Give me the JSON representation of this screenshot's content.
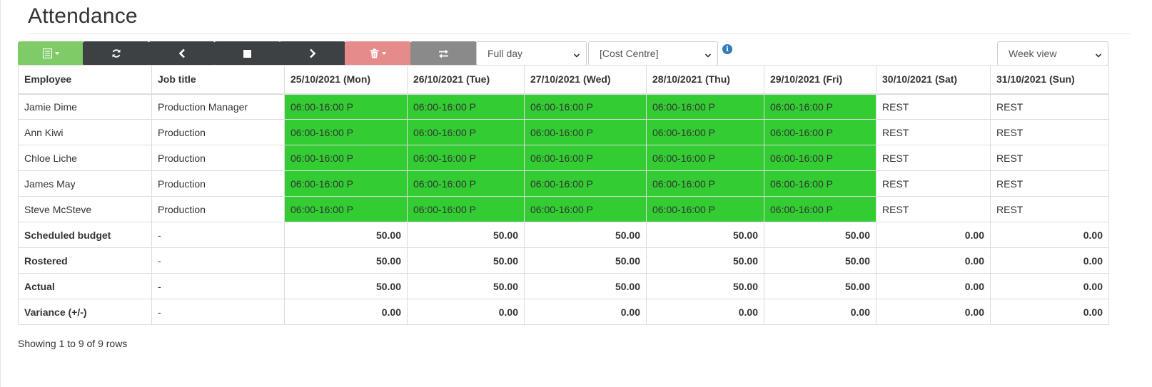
{
  "page": {
    "title": "Attendance",
    "footer": "Showing 1 to 9 of 9 rows"
  },
  "toolbar": {
    "icons": [
      "spreadsheet-icon",
      "refresh-icon",
      "chevron-left-icon",
      "stop-icon",
      "chevron-right-icon",
      "trash-icon",
      "swap-icon"
    ],
    "filter_select_value": "Full day",
    "cost_centre_value": "[Cost Centre]",
    "view_select_value": "Week view",
    "colors": {
      "green": "#7ecb67",
      "dark": "#3d4144",
      "red": "#e58b8b",
      "grey": "#8a8a8a",
      "shift": "#33cc33",
      "info": "#337ab7"
    }
  },
  "table": {
    "headers": [
      "Employee",
      "Job title",
      "25/10/2021 (Mon)",
      "26/10/2021 (Tue)",
      "27/10/2021 (Wed)",
      "28/10/2021 (Thu)",
      "29/10/2021 (Fri)",
      "30/10/2021 (Sat)",
      "31/10/2021 (Sun)"
    ],
    "employees": [
      {
        "name": "Jamie Dime",
        "job": "Production Manager",
        "days": [
          "06:00-16:00 P",
          "06:00-16:00 P",
          "06:00-16:00 P",
          "06:00-16:00 P",
          "06:00-16:00 P",
          "REST",
          "REST"
        ]
      },
      {
        "name": "Ann Kiwi",
        "job": "Production",
        "days": [
          "06:00-16:00 P",
          "06:00-16:00 P",
          "06:00-16:00 P",
          "06:00-16:00 P",
          "06:00-16:00 P",
          "REST",
          "REST"
        ]
      },
      {
        "name": "Chloe Liche",
        "job": "Production",
        "days": [
          "06:00-16:00 P",
          "06:00-16:00 P",
          "06:00-16:00 P",
          "06:00-16:00 P",
          "06:00-16:00 P",
          "REST",
          "REST"
        ]
      },
      {
        "name": "James May",
        "job": "Production",
        "days": [
          "06:00-16:00 P",
          "06:00-16:00 P",
          "06:00-16:00 P",
          "06:00-16:00 P",
          "06:00-16:00 P",
          "REST",
          "REST"
        ]
      },
      {
        "name": "Steve McSteve",
        "job": "Production",
        "days": [
          "06:00-16:00 P",
          "06:00-16:00 P",
          "06:00-16:00 P",
          "06:00-16:00 P",
          "06:00-16:00 P",
          "REST",
          "REST"
        ]
      }
    ],
    "totals": [
      {
        "label": "Scheduled budget",
        "job": "-",
        "values": [
          "50.00",
          "50.00",
          "50.00",
          "50.00",
          "50.00",
          "0.00",
          "0.00"
        ]
      },
      {
        "label": "Rostered",
        "job": "-",
        "values": [
          "50.00",
          "50.00",
          "50.00",
          "50.00",
          "50.00",
          "0.00",
          "0.00"
        ]
      },
      {
        "label": "Actual",
        "job": "-",
        "values": [
          "50.00",
          "50.00",
          "50.00",
          "50.00",
          "50.00",
          "0.00",
          "0.00"
        ]
      },
      {
        "label": "Variance (+/-)",
        "job": "-",
        "values": [
          "0.00",
          "0.00",
          "0.00",
          "0.00",
          "0.00",
          "0.00",
          "0.00"
        ]
      }
    ]
  }
}
